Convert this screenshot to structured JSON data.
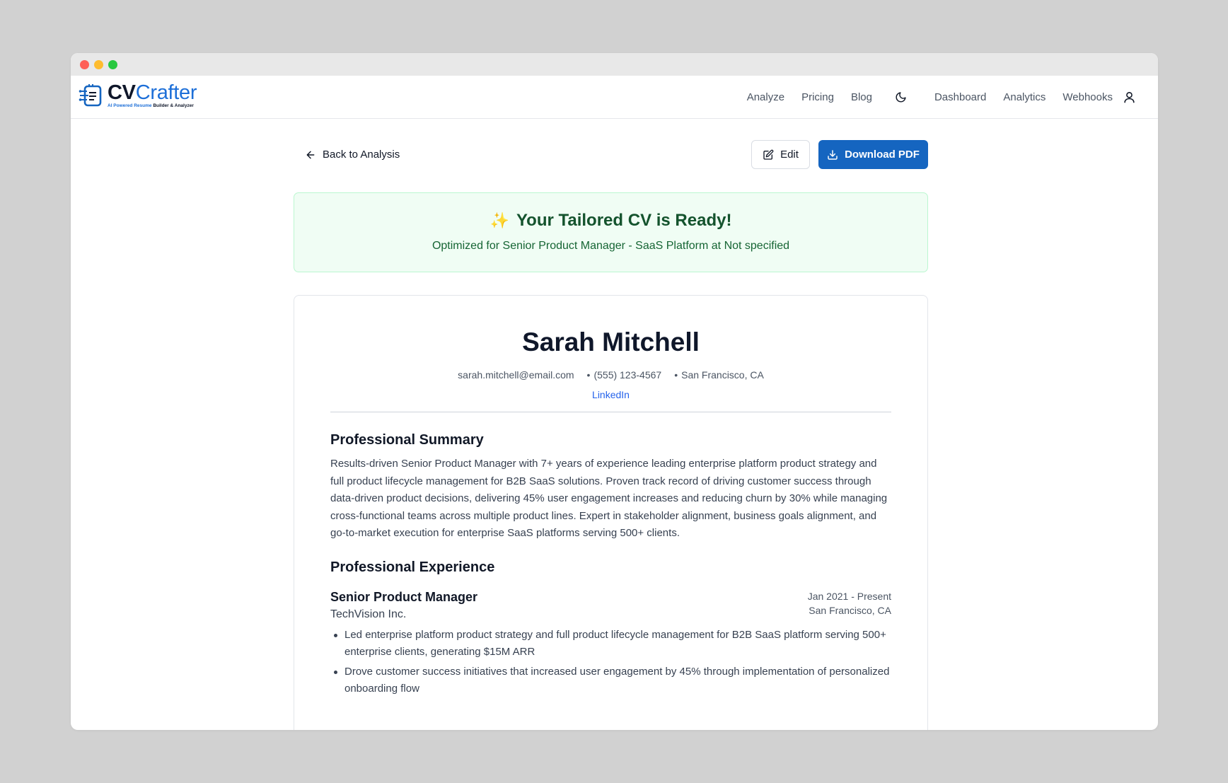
{
  "brand": {
    "name_cv": "CV",
    "name_rest": "Crafter",
    "tagline_a": "AI Powered Resume",
    "tagline_b": "Builder & Analyzer",
    "colors": {
      "primary": "#1565c0",
      "dark": "#0f172a"
    }
  },
  "nav": {
    "links": [
      "Analyze",
      "Pricing",
      "Blog"
    ],
    "links_right": [
      "Dashboard",
      "Analytics",
      "Webhooks"
    ],
    "icons": [
      "moon-icon",
      "user-icon"
    ]
  },
  "actions": {
    "back_label": "Back to Analysis",
    "edit_label": "Edit",
    "download_label": "Download PDF"
  },
  "banner": {
    "emoji": "✨",
    "title": "Your Tailored CV is Ready!",
    "subtitle": "Optimized for Senior Product Manager - SaaS Platform at Not specified"
  },
  "cv": {
    "name": "Sarah Mitchell",
    "email": "sarah.mitchell@email.com",
    "phone": "(555) 123-4567",
    "location": "San Francisco, CA",
    "separator": "•",
    "linkedin": "LinkedIn",
    "summary_heading": "Professional Summary",
    "summary": "Results-driven Senior Product Manager with 7+ years of experience leading enterprise platform product strategy and full product lifecycle management for B2B SaaS solutions. Proven track record of driving customer success through data-driven product decisions, delivering 45% user engagement increases and reducing churn by 30% while managing cross-functional teams across multiple product lines. Expert in stakeholder alignment, business goals alignment, and go-to-market execution for enterprise SaaS platforms serving 500+ clients.",
    "experience_heading": "Professional Experience",
    "jobs": [
      {
        "role": "Senior Product Manager",
        "company": "TechVision Inc.",
        "dates": "Jan 2021 - Present",
        "location": "San Francisco, CA",
        "bullets": [
          "Led enterprise platform product strategy and full product lifecycle management for B2B SaaS platform serving 500+ enterprise clients, generating $15M ARR",
          "Drove customer success initiatives that increased user engagement by 45% through implementation of personalized onboarding flow"
        ]
      }
    ]
  }
}
